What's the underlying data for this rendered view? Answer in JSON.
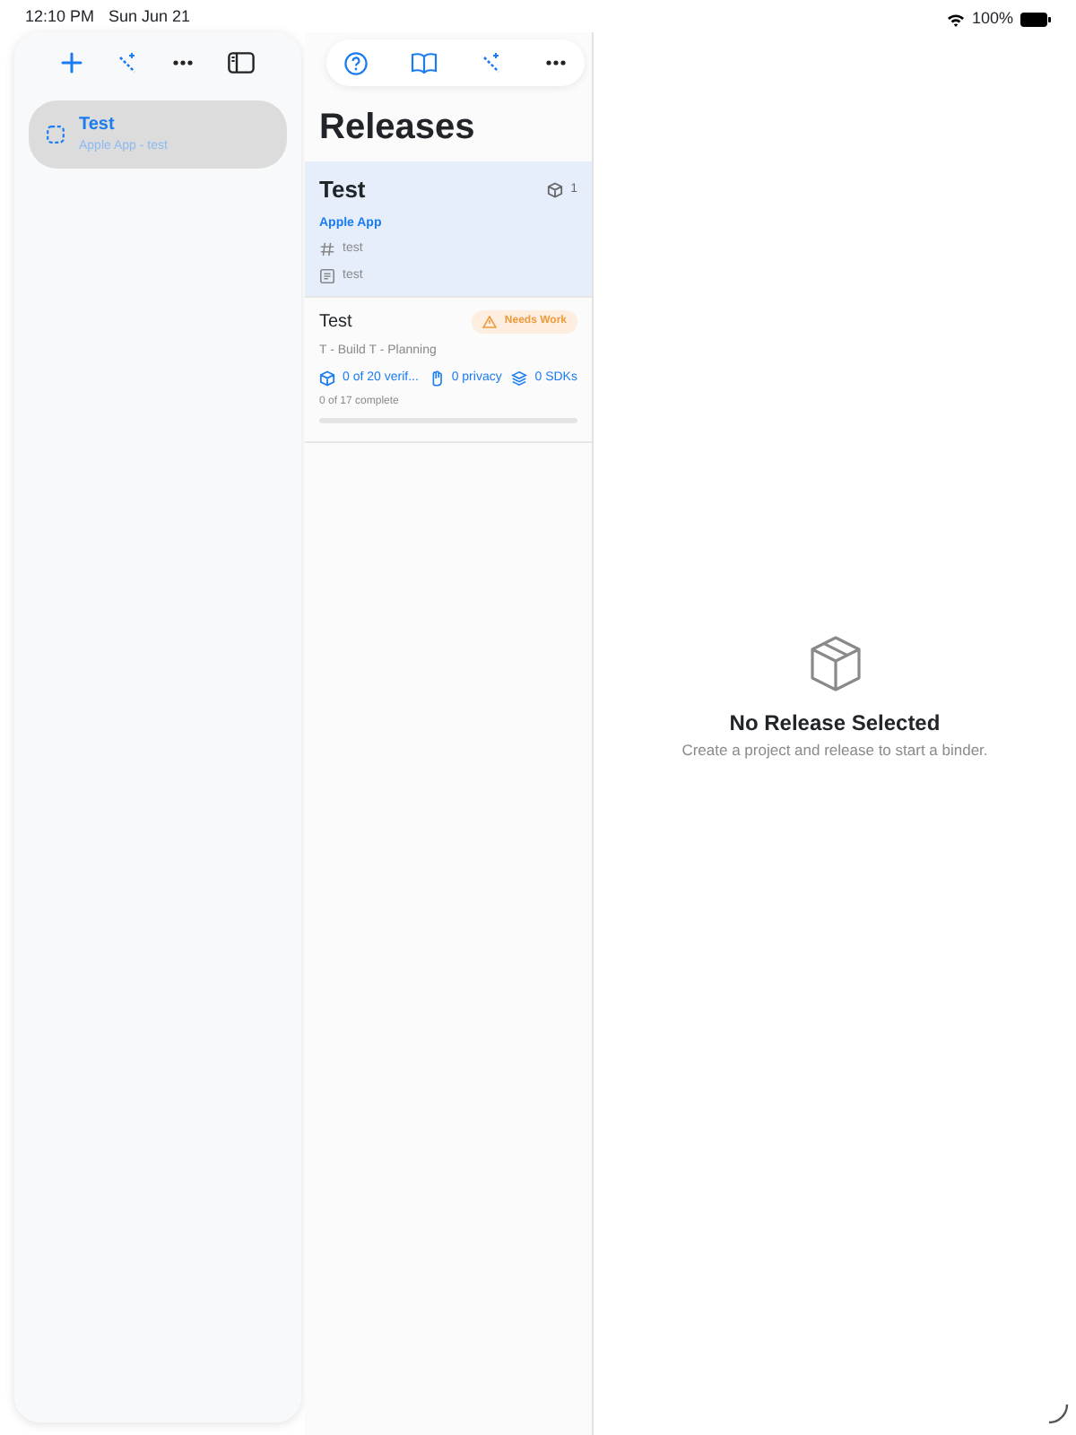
{
  "status_bar": {
    "time": "12:10 PM",
    "date": "Sun Jun 21",
    "battery": "100%"
  },
  "sidebar": {
    "items": [
      {
        "title": "Test",
        "subtitle": "Apple App - test",
        "selected": true
      }
    ]
  },
  "releases": {
    "title": "Releases",
    "items": [
      {
        "kind": "summary",
        "selected": true,
        "title": "Test",
        "count": "1",
        "app": "Apple App",
        "tags": [
          {
            "kind": "hash",
            "text": "test"
          },
          {
            "kind": "doc",
            "text": "test"
          }
        ]
      },
      {
        "kind": "progress",
        "selected": false,
        "title": "Test",
        "badge": "Needs Work",
        "subtitle": "T - Build T - Planning",
        "stats": [
          {
            "kind": "cube",
            "text": "0 of 20 verif..."
          },
          {
            "kind": "hand",
            "text": "0 privacy"
          },
          {
            "kind": "layers",
            "text": "0 SDKs"
          }
        ],
        "progress_text": "0 of 17 complete",
        "level": 0
      }
    ]
  },
  "detail": {
    "title": "No Release Selected",
    "message": "Create a project and release to start a binder."
  }
}
